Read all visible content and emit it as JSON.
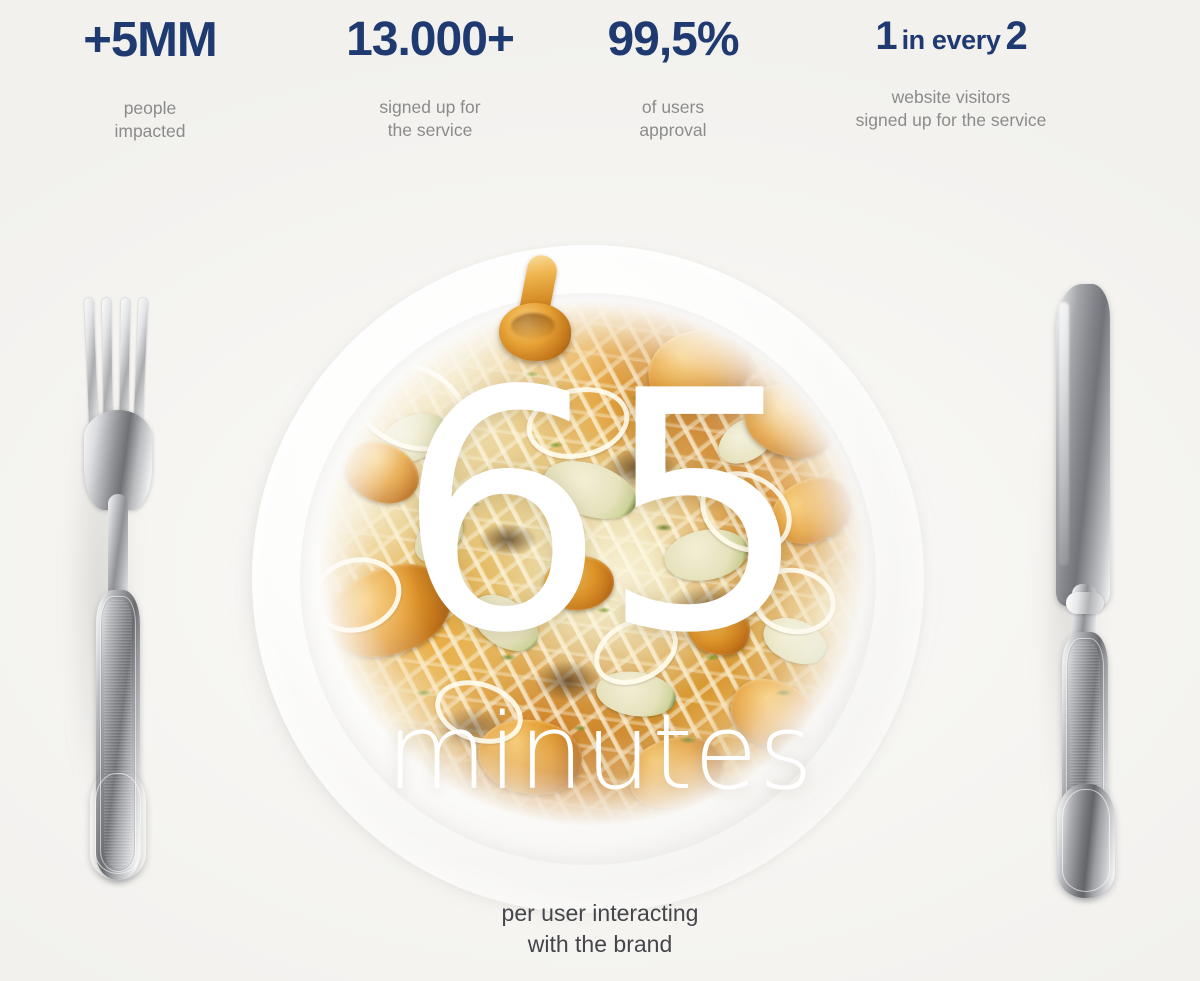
{
  "background_color": "#f7f6f3",
  "accent_color": "#1e3a70",
  "caption_color": "#8b8b8b",
  "stats": [
    {
      "value": "+5MM",
      "caption": "people\nimpacted"
    },
    {
      "value": "13.000+",
      "caption": "signed up for\nthe service"
    },
    {
      "value": "99,5%",
      "caption": "of users\napproval"
    },
    {
      "value_lead": "1",
      "value_mid": "in every",
      "value_trail": "2",
      "caption": "website visitors\nsigned up for the service"
    }
  ],
  "hero": {
    "number": "65",
    "unit": "minutes",
    "caption": "per user interacting\nwith the brand",
    "number_color": "#ffffff"
  },
  "scene": {
    "plate_label": "white dinner plate",
    "food_label": "spaghetti with chanterelle mushrooms, zucchini and herbs",
    "fork_label": "silver dinner fork",
    "knife_label": "silver dinner knife"
  }
}
